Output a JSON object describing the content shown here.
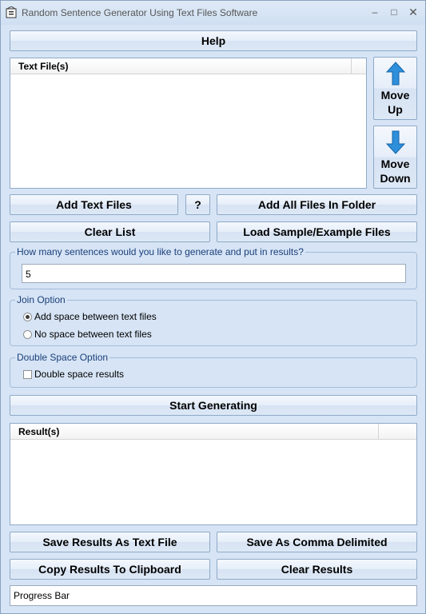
{
  "window": {
    "title": "Random Sentence Generator Using Text Files Software"
  },
  "buttons": {
    "help": "Help",
    "move_up": "Move Up",
    "move_down": "Move Down",
    "add_text_files": "Add Text Files",
    "question": "?",
    "add_all_files_in_folder": "Add All Files In Folder",
    "clear_list": "Clear List",
    "load_sample": "Load Sample/Example Files",
    "start_generating": "Start Generating",
    "save_results_text": "Save Results As Text File",
    "save_comma": "Save As Comma Delimited",
    "copy_clipboard": "Copy Results To Clipboard",
    "clear_results": "Clear Results"
  },
  "text_files_list": {
    "header": "Text File(s)",
    "items": []
  },
  "sentences_group": {
    "legend": "How many sentences would you like to generate and put in results?",
    "value": "5"
  },
  "join_option": {
    "legend": "Join Option",
    "options": [
      {
        "label": "Add space between text files",
        "selected": true
      },
      {
        "label": "No space between text files",
        "selected": false
      }
    ]
  },
  "double_space_option": {
    "legend": "Double Space Option",
    "checkbox_label": "Double space results",
    "checked": false
  },
  "results_list": {
    "header": "Result(s)",
    "items": []
  },
  "progress_bar": {
    "label": "Progress Bar"
  },
  "colors": {
    "window_bg": "#d6e4f5",
    "arrow_blue": "#2e8fdb",
    "legend_text": "#1b3f7a"
  }
}
